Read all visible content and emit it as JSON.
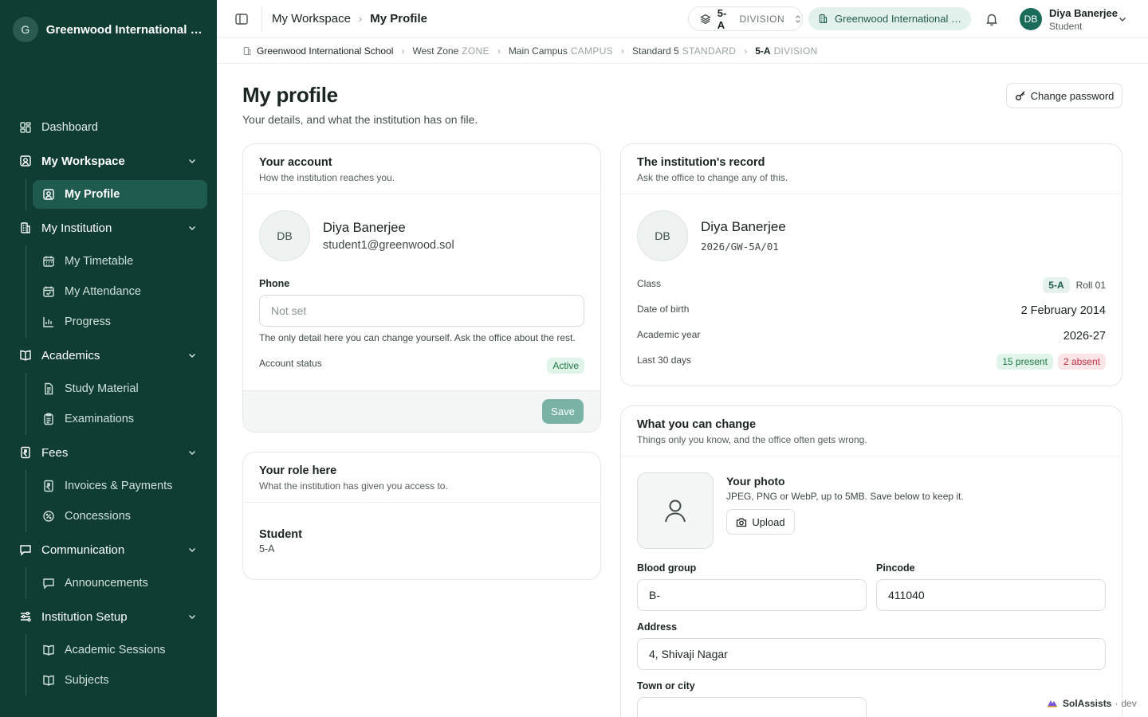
{
  "sidebar": {
    "logo_letter": "G",
    "school": "Greenwood International School",
    "items": {
      "dashboard": "Dashboard",
      "my_workspace": "My Workspace",
      "my_profile": "My Profile",
      "my_institution": "My Institution",
      "my_timetable": "My Timetable",
      "my_attendance": "My Attendance",
      "progress": "Progress",
      "academics": "Academics",
      "study_material": "Study Material",
      "examinations": "Examinations",
      "fees": "Fees",
      "invoices": "Invoices & Payments",
      "concessions": "Concessions",
      "communication": "Communication",
      "announcements": "Announcements",
      "institution_setup": "Institution Setup",
      "academic_sessions": "Academic Sessions",
      "subjects": "Subjects"
    }
  },
  "topbar": {
    "crumb_parent": "My Workspace",
    "crumb_current": "My Profile",
    "division_code": "5-A",
    "division_label": "DIVISION",
    "school_pill": "Greenwood International School",
    "user_initials": "DB",
    "user_name": "Diya Banerjee",
    "user_role": "Student"
  },
  "breadcrumb": {
    "school": "Greenwood International School",
    "zone": "West Zone",
    "zone_kind": "ZONE",
    "campus": "Main Campus",
    "campus_kind": "CAMPUS",
    "standard": "Standard 5",
    "standard_kind": "STANDARD",
    "division": "5-A",
    "division_kind": "DIVISION"
  },
  "page": {
    "title": "My profile",
    "subtitle": "Your details, and what the institution has on file.",
    "change_password": "Change password"
  },
  "account_card": {
    "title": "Your account",
    "subtitle": "How the institution reaches you.",
    "initials": "DB",
    "name": "Diya Banerjee",
    "email": "student1@greenwood.sol",
    "phone_label": "Phone",
    "phone_placeholder": "Not set",
    "phone_help": "The only detail here you can change yourself. Ask the office about the rest.",
    "status_label": "Account status",
    "status_value": "Active",
    "save": "Save"
  },
  "role_card": {
    "title": "Your role here",
    "subtitle": "What the institution has given you access to.",
    "role": "Student",
    "scope": "5-A"
  },
  "record_card": {
    "title": "The institution's record",
    "subtitle": "Ask the office to change any of this.",
    "initials": "DB",
    "name": "Diya Banerjee",
    "student_id": "2026/GW-5A/01",
    "class_label": "Class",
    "class_value": "5-A",
    "roll": "Roll 01",
    "dob_label": "Date of birth",
    "dob_value": "2 February 2014",
    "year_label": "Academic year",
    "year_value": "2026-27",
    "last30_label": "Last 30 days",
    "present": "15 present",
    "absent": "2 absent"
  },
  "editable_card": {
    "title": "What you can change",
    "subtitle": "Things only you know, and the office often gets wrong.",
    "photo_title": "Your photo",
    "photo_help": "JPEG, PNG or WebP, up to 5MB. Save below to keep it.",
    "upload": "Upload",
    "blood_group_label": "Blood group",
    "blood_group_value": "B-",
    "pincode_label": "Pincode",
    "pincode_value": "411040",
    "address_label": "Address",
    "address_value": "4, Shivaji Nagar",
    "town_label": "Town or city",
    "town_value": ""
  },
  "footer_badge": {
    "brand": "SolAssists",
    "env": "dev"
  },
  "colors": {
    "sidebar_bg": "#0f3d34",
    "accent": "#1b6b5a",
    "active_green": "#1f7a45",
    "absent_red": "#c23142"
  }
}
